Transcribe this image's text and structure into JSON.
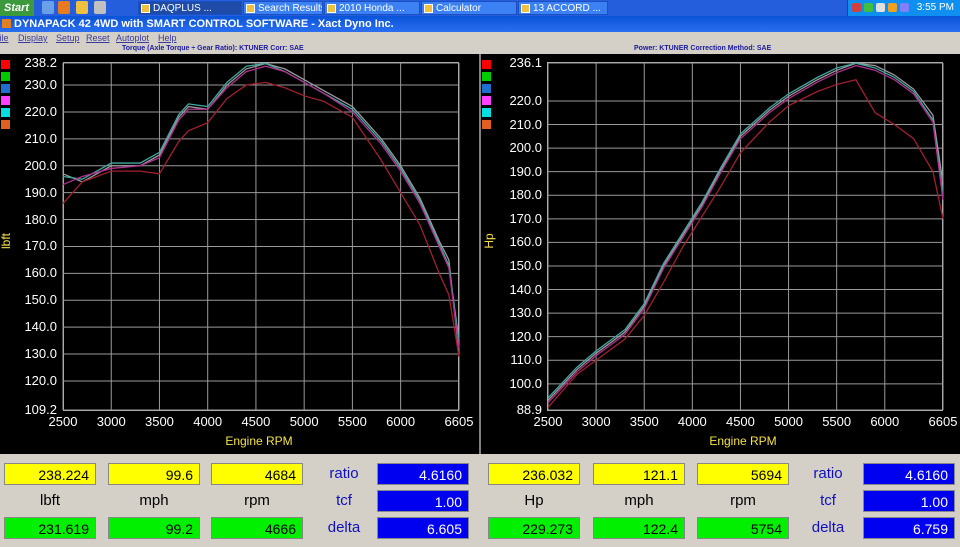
{
  "taskbar": {
    "start": "Start",
    "buttons": [
      {
        "label": "DAQPLUS ...",
        "active": true
      },
      {
        "label": "Search Results"
      },
      {
        "label": "2010 Honda ..."
      },
      {
        "label": "Calculator"
      },
      {
        "label": "13 ACCORD ..."
      }
    ],
    "clock": "3:55 PM"
  },
  "window": {
    "title": "DYNAPACK 42 4WD with SMART CONTROL SOFTWARE - Xact Dyno Inc.",
    "menu": [
      "File",
      "Display",
      "Setup",
      "Reset",
      "Autoplot",
      "Help"
    ]
  },
  "colors": {
    "series": [
      "#ff0000",
      "#00cc00",
      "#1f6fd0",
      "#ff40ff",
      "#00e0e0",
      "#e06020"
    ],
    "curve_lines": [
      "#9a9a9a",
      "#40a8a0",
      "#b03090",
      "#a02030"
    ]
  },
  "torque": {
    "subtitle": "Torque (Axle Torque ÷ Gear Ratio): KTUNER      Corr: SAE",
    "ylabel": "lbft",
    "xlabel": "Engine RPM",
    "yticks": [
      "238.2",
      "230.0",
      "220.0",
      "210.0",
      "200.0",
      "190.0",
      "180.0",
      "170.0",
      "160.0",
      "150.0",
      "140.0",
      "130.0",
      "120.0",
      "109.2"
    ],
    "xticks": [
      "2500",
      "3000",
      "3500",
      "4000",
      "4500",
      "5000",
      "5500",
      "6000",
      "6605"
    ]
  },
  "power": {
    "subtitle": "Power: KTUNER      Correction Method: SAE",
    "ylabel": "Hp",
    "xlabel": "Engine RPM",
    "yticks": [
      "236.1",
      "220.0",
      "210.0",
      "200.0",
      "190.0",
      "180.0",
      "170.0",
      "160.0",
      "150.0",
      "140.0",
      "130.0",
      "120.0",
      "110.0",
      "100.0",
      "88.9"
    ],
    "xticks": [
      "2500",
      "3000",
      "3500",
      "4000",
      "4500",
      "5000",
      "5500",
      "6000",
      "6605"
    ]
  },
  "chart_data": [
    {
      "type": "line",
      "title": "",
      "xlabel": "Engine RPM",
      "ylabel": "lbft",
      "xlim": [
        2500,
        6605
      ],
      "ylim": [
        109.2,
        238.2
      ],
      "series": [
        {
          "x": [
            2500,
            2700,
            3000,
            3300,
            3500,
            3700,
            3800,
            4000,
            4200,
            4400,
            4600,
            4800,
            5000,
            5200,
            5500,
            5800,
            6000,
            6200,
            6400,
            6500,
            6605
          ],
          "values": [
            197,
            194,
            200,
            200,
            204,
            218,
            222,
            221,
            230,
            236,
            238,
            236,
            232,
            228,
            222,
            210,
            200,
            188,
            172,
            165,
            130
          ]
        },
        {
          "x": [
            2500,
            2700,
            3000,
            3300,
            3500,
            3700,
            3800,
            4000,
            4200,
            4400,
            4600,
            4800,
            5000,
            5200,
            5500,
            5800,
            6000,
            6200,
            6400,
            6500,
            6605
          ],
          "values": [
            196,
            195,
            201,
            201,
            205,
            219,
            223,
            222,
            231,
            237,
            238,
            235,
            231,
            227,
            221,
            209,
            199,
            187,
            171,
            163,
            135
          ]
        },
        {
          "x": [
            2500,
            2700,
            3000,
            3300,
            3500,
            3700,
            3800,
            4000,
            4200,
            4400,
            4600,
            4800,
            5000,
            5200,
            5500,
            5800,
            6000,
            6200,
            6400,
            6500,
            6605
          ],
          "values": [
            193,
            196,
            199,
            200,
            203,
            217,
            221,
            221,
            229,
            235,
            237,
            235,
            231,
            227,
            220,
            208,
            198,
            186,
            170,
            162,
            132
          ]
        },
        {
          "x": [
            2500,
            2700,
            3000,
            3300,
            3500,
            3700,
            3800,
            4000,
            4200,
            4400,
            4600,
            4800,
            5000,
            5200,
            5500,
            5800,
            6000,
            6200,
            6400,
            6500,
            6605
          ],
          "values": [
            186,
            194,
            198,
            198,
            197,
            209,
            213,
            216,
            225,
            230,
            231,
            229,
            226,
            224,
            218,
            202,
            190,
            178,
            160,
            152,
            129
          ]
        }
      ]
    },
    {
      "type": "line",
      "title": "",
      "xlabel": "Engine RPM",
      "ylabel": "Hp",
      "xlim": [
        2500,
        6605
      ],
      "ylim": [
        88.9,
        236.1
      ],
      "series": [
        {
          "x": [
            2500,
            2800,
            3000,
            3300,
            3500,
            3700,
            3900,
            4100,
            4300,
            4500,
            4800,
            5000,
            5300,
            5500,
            5700,
            5900,
            6100,
            6300,
            6500,
            6605
          ],
          "values": [
            93,
            106,
            113,
            122,
            133,
            150,
            163,
            176,
            191,
            205,
            216,
            222,
            229,
            233,
            236,
            235,
            231,
            225,
            214,
            185
          ]
        },
        {
          "x": [
            2500,
            2800,
            3000,
            3300,
            3500,
            3700,
            3900,
            4100,
            4300,
            4500,
            4800,
            5000,
            5300,
            5500,
            5700,
            5900,
            6100,
            6300,
            6500,
            6605
          ],
          "values": [
            94,
            107,
            114,
            123,
            134,
            151,
            164,
            177,
            192,
            206,
            217,
            223,
            230,
            234,
            236,
            234,
            230,
            224,
            212,
            180
          ]
        },
        {
          "x": [
            2500,
            2800,
            3000,
            3300,
            3500,
            3700,
            3900,
            4100,
            4300,
            4500,
            4800,
            5000,
            5300,
            5500,
            5700,
            5900,
            6100,
            6300,
            6500,
            6605
          ],
          "values": [
            92,
            105,
            112,
            121,
            132,
            149,
            162,
            175,
            190,
            204,
            215,
            221,
            228,
            232,
            235,
            233,
            229,
            223,
            211,
            178
          ]
        },
        {
          "x": [
            2500,
            2800,
            3000,
            3300,
            3500,
            3700,
            3900,
            4100,
            4300,
            4500,
            4800,
            5000,
            5300,
            5500,
            5700,
            5900,
            6100,
            6300,
            6500,
            6605
          ],
          "values": [
            90,
            104,
            110,
            119,
            129,
            143,
            158,
            171,
            184,
            198,
            211,
            218,
            224,
            227,
            229,
            215,
            210,
            204,
            190,
            170
          ]
        }
      ]
    }
  ],
  "readout_left": {
    "top": [
      "238.224",
      "99.6",
      "4684"
    ],
    "units": [
      "lbft",
      "mph",
      "rpm"
    ],
    "bottom": [
      "231.619",
      "99.2",
      "4666"
    ],
    "labels": [
      "ratio",
      "tcf",
      "delta"
    ],
    "blue": [
      "4.6160",
      "1.00",
      "6.605"
    ]
  },
  "readout_right": {
    "top": [
      "236.032",
      "121.1",
      "5694"
    ],
    "units": [
      "Hp",
      "mph",
      "rpm"
    ],
    "bottom": [
      "229.273",
      "122.4",
      "5754"
    ],
    "labels": [
      "ratio",
      "tcf",
      "delta"
    ],
    "blue": [
      "4.6160",
      "1.00",
      "6.759"
    ]
  }
}
